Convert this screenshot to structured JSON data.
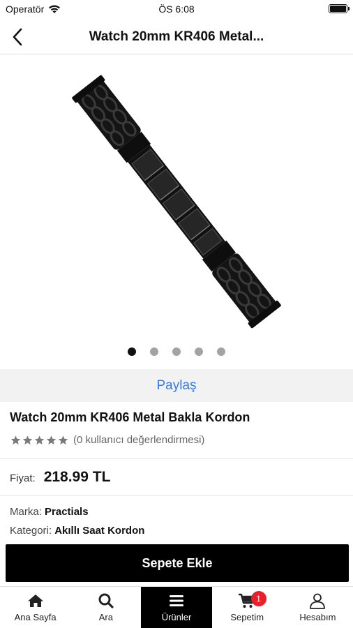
{
  "status_bar": {
    "carrier": "Operatör",
    "time": "ÖS 6:08"
  },
  "nav": {
    "title": "Watch 20mm KR406 Metal..."
  },
  "gallery": {
    "image_count": 5,
    "active_index": 0
  },
  "share": {
    "label": "Paylaş"
  },
  "product": {
    "title": "Watch 20mm KR406 Metal Bakla Kordon",
    "rating_value": 0,
    "rating_max": 5,
    "rating_text": "(0 kullanıcı değerlendirmesi)",
    "price_label": "Fiyat:",
    "price": "218.99 TL",
    "brand_label": "Marka:",
    "brand": "Practials",
    "category_label": "Kategori:",
    "category": "Akıllı Saat Kordon"
  },
  "actions": {
    "add_to_cart": "Sepete Ekle"
  },
  "tab_bar": {
    "items": [
      {
        "label": "Ana Sayfa",
        "icon": "home-icon"
      },
      {
        "label": "Ara",
        "icon": "search-icon"
      },
      {
        "label": "Ürünler",
        "icon": "menu-icon"
      },
      {
        "label": "Sepetim",
        "icon": "cart-icon"
      },
      {
        "label": "Hesabım",
        "icon": "user-icon"
      }
    ],
    "active_index": 2,
    "cart_badge": "1"
  },
  "colors": {
    "accent_link": "#2f7bf0",
    "button_bg": "#000000",
    "badge": "#e8202a"
  }
}
